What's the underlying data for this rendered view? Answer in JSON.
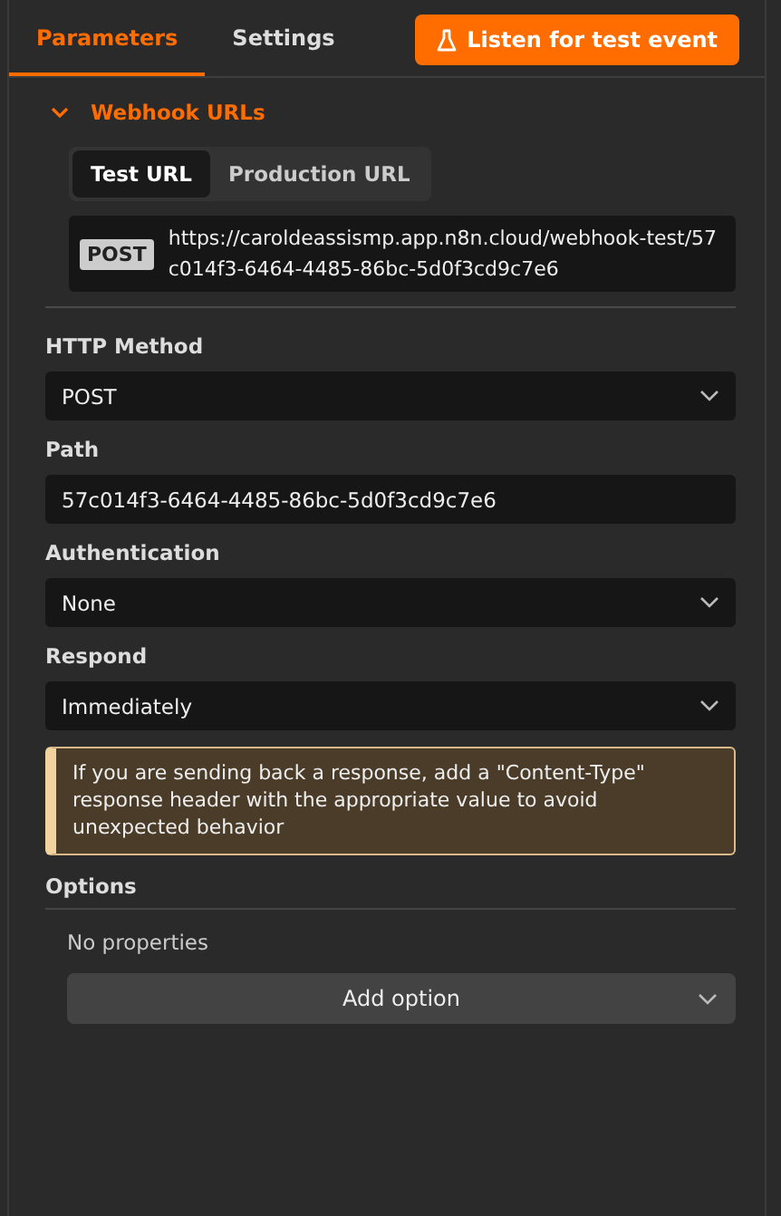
{
  "tabs": [
    {
      "label": "Parameters",
      "selected": true
    },
    {
      "label": "Settings",
      "selected": false
    }
  ],
  "listen_button": {
    "label": "Listen for test event"
  },
  "webhook_urls": {
    "title": "Webhook URLs",
    "expanded": true,
    "url_tabs": [
      {
        "label": "Test URL",
        "selected": true
      },
      {
        "label": "Production URL",
        "selected": false
      }
    ],
    "method_badge": "POST",
    "url": "https://caroldeassismp.app.n8n.cloud/webhook-test/57c014f3-6464-4485-86bc-5d0f3cd9c7e6"
  },
  "fields": [
    {
      "label": "HTTP Method",
      "kind": "select",
      "value": "POST"
    },
    {
      "label": "Path",
      "kind": "input",
      "value": "57c014f3-6464-4485-86bc-5d0f3cd9c7e6"
    },
    {
      "label": "Authentication",
      "kind": "select",
      "value": "None"
    },
    {
      "label": "Respond",
      "kind": "select",
      "value": "Immediately"
    }
  ],
  "notice": "If you are sending back a response, add a \"Content-Type\" response header with the appropriate value to avoid unexpected behavior",
  "options": {
    "title": "Options",
    "empty_text": "No properties",
    "add_button": "Add option"
  }
}
